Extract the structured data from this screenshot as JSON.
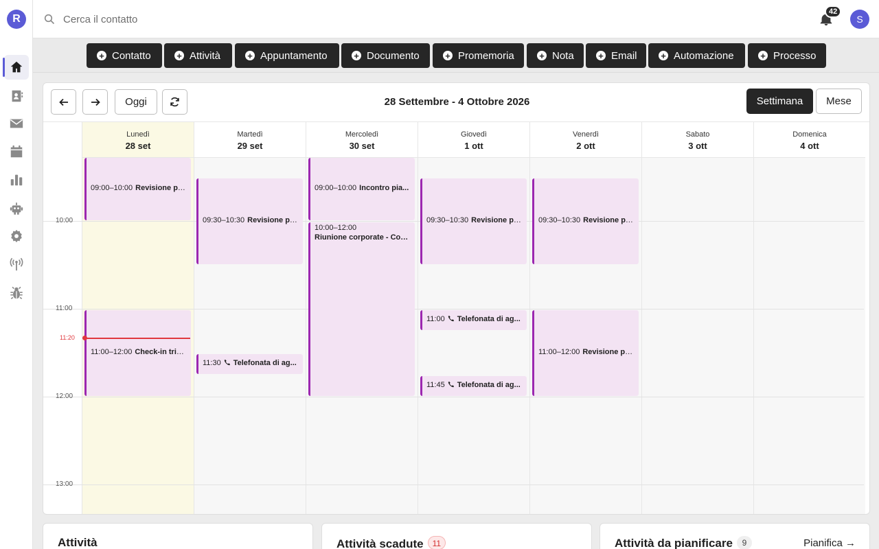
{
  "brand": {
    "logo_letter": "R",
    "accent": "#5b5bd6"
  },
  "sidebar": {
    "items": [
      {
        "name": "home",
        "icon": "home-icon",
        "active": true
      },
      {
        "name": "contacts",
        "icon": "contact-book-icon",
        "active": false
      },
      {
        "name": "email",
        "icon": "envelope-icon",
        "active": false
      },
      {
        "name": "calendar",
        "icon": "calendar-icon",
        "active": false
      },
      {
        "name": "reports",
        "icon": "bar-chart-icon",
        "active": false
      },
      {
        "name": "automation",
        "icon": "robot-icon",
        "active": false
      },
      {
        "name": "settings",
        "icon": "gear-icon",
        "active": false
      },
      {
        "name": "integrations",
        "icon": "antenna-icon",
        "active": false
      },
      {
        "name": "debug",
        "icon": "bug-icon",
        "active": false
      }
    ]
  },
  "topbar": {
    "search_placeholder": "Cerca il contatto",
    "notifications_count": "42",
    "user_initial": "S"
  },
  "quick_actions": [
    "Contatto",
    "Attività",
    "Appuntamento",
    "Documento",
    "Promemoria",
    "Nota",
    "Email",
    "Automazione",
    "Processo"
  ],
  "calendar": {
    "nav": {
      "today": "Oggi"
    },
    "range_title": "28 Settembre - 4 Ottobre 2026",
    "views": {
      "week": "Settimana",
      "month": "Mese",
      "active": "week"
    },
    "days": [
      {
        "name": "Lunedì",
        "date": "28 set",
        "today": true
      },
      {
        "name": "Martedì",
        "date": "29 set",
        "today": false
      },
      {
        "name": "Mercoledì",
        "date": "30 set",
        "today": false
      },
      {
        "name": "Giovedì",
        "date": "1 ott",
        "today": false
      },
      {
        "name": "Venerdì",
        "date": "2 ott",
        "today": false
      },
      {
        "name": "Sabato",
        "date": "3 ott",
        "today": false
      },
      {
        "name": "Domenica",
        "date": "4 ott",
        "today": false
      }
    ],
    "hours": [
      "10:00",
      "11:00",
      "12:00",
      "13:00"
    ],
    "now": "11:20",
    "events": [
      {
        "day": 0,
        "start": "09:00",
        "end": "10:00",
        "time": "09:00–10:00",
        "title": "Revisione po...",
        "type": "meeting",
        "layout": "inline"
      },
      {
        "day": 0,
        "start": "11:00",
        "end": "12:00",
        "time": "11:00–12:00",
        "title": "Check-in trim...",
        "type": "meeting",
        "layout": "inline"
      },
      {
        "day": 1,
        "start": "09:30",
        "end": "10:30",
        "time": "09:30–10:30",
        "title": "Revisione po...",
        "type": "meeting",
        "layout": "inline"
      },
      {
        "day": 1,
        "start": "11:30",
        "end": "11:45",
        "time": "11:30",
        "title": "Telefonata di ag...",
        "type": "call",
        "layout": "inline"
      },
      {
        "day": 2,
        "start": "09:00",
        "end": "10:00",
        "time": "09:00–10:00",
        "title": "Incontro pia...",
        "type": "meeting",
        "layout": "inline"
      },
      {
        "day": 2,
        "start": "10:00",
        "end": "12:00",
        "time": "10:00–12:00",
        "title": "Riunione corporate - Con...",
        "type": "meeting",
        "layout": "stacked"
      },
      {
        "day": 3,
        "start": "09:30",
        "end": "10:30",
        "time": "09:30–10:30",
        "title": "Revisione po...",
        "type": "meeting",
        "layout": "inline"
      },
      {
        "day": 3,
        "start": "11:00",
        "end": "11:15",
        "time": "11:00",
        "title": "Telefonata di ag...",
        "type": "call",
        "layout": "inline"
      },
      {
        "day": 3,
        "start": "11:45",
        "end": "12:00",
        "time": "11:45",
        "title": "Telefonata di ag...",
        "type": "call",
        "layout": "inline"
      },
      {
        "day": 4,
        "start": "09:30",
        "end": "10:30",
        "time": "09:30–10:30",
        "title": "Revisione po...",
        "type": "meeting",
        "layout": "inline"
      },
      {
        "day": 4,
        "start": "11:00",
        "end": "12:00",
        "time": "11:00–12:00",
        "title": "Revisione por...",
        "type": "meeting",
        "layout": "inline"
      }
    ]
  },
  "panels": [
    {
      "title": "Attività"
    },
    {
      "title": "Attività scadute",
      "count": "11",
      "count_style": "red"
    },
    {
      "title": "Attività da pianificare",
      "count": "9",
      "count_style": "grey",
      "link": "Pianifica →"
    }
  ]
}
